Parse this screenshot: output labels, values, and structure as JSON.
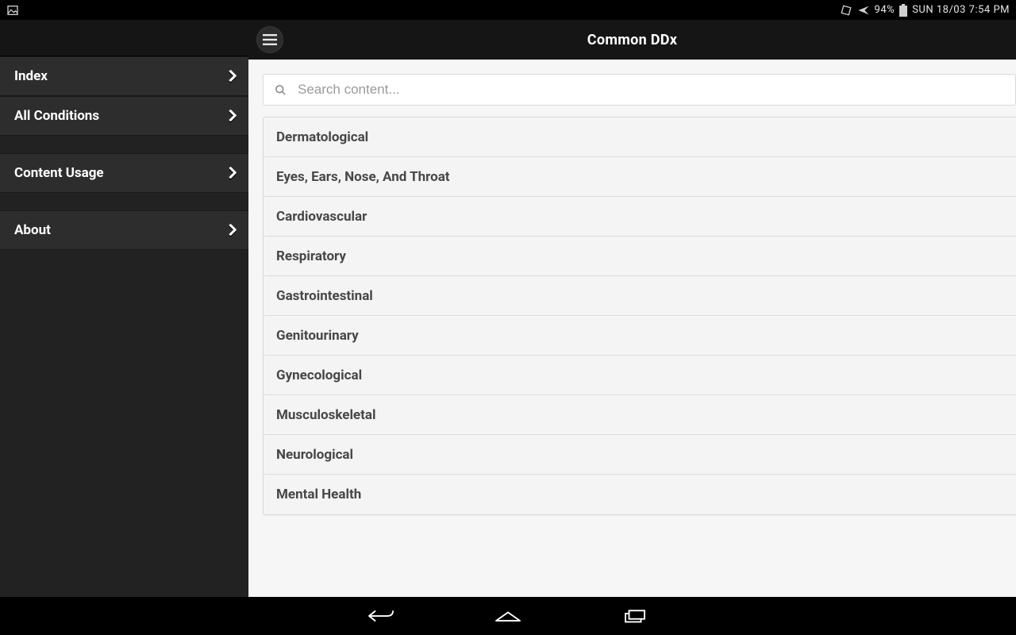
{
  "status": {
    "battery": "94%",
    "datetime": "SUN 18/03 7:54 PM"
  },
  "sidebar": {
    "items": [
      {
        "label": "Index"
      },
      {
        "label": "All Conditions"
      },
      {
        "label": "Content Usage"
      },
      {
        "label": "About"
      }
    ]
  },
  "header": {
    "title": "Common DDx"
  },
  "search": {
    "placeholder": "Search content..."
  },
  "categories": [
    {
      "label": "Dermatological"
    },
    {
      "label": "Eyes, Ears, Nose, And Throat"
    },
    {
      "label": "Cardiovascular"
    },
    {
      "label": "Respiratory"
    },
    {
      "label": "Gastrointestinal"
    },
    {
      "label": "Genitourinary"
    },
    {
      "label": "Gynecological"
    },
    {
      "label": "Musculoskeletal"
    },
    {
      "label": "Neurological"
    },
    {
      "label": "Mental Health"
    }
  ]
}
